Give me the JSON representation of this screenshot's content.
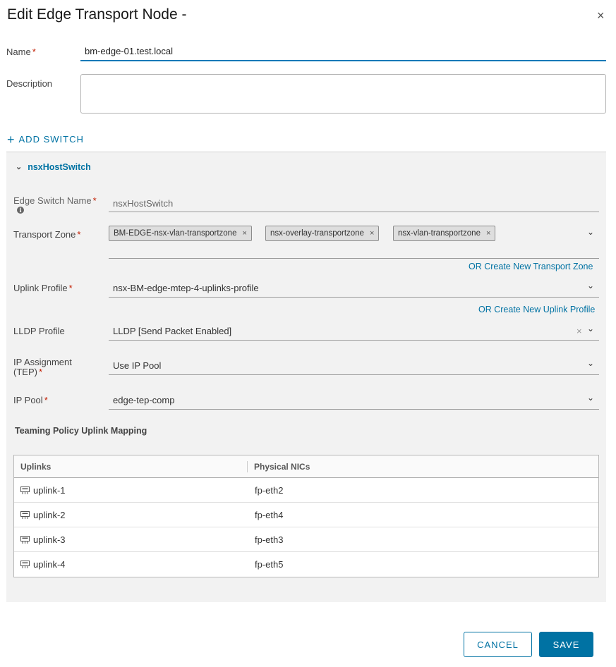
{
  "dialog": {
    "title": "Edit Edge Transport Node -",
    "close_glyph": "×"
  },
  "form": {
    "name_label": "Name",
    "required_mark": "*",
    "name_value": "bm-edge-01.test.local",
    "description_label": "Description",
    "description_value": ""
  },
  "add_switch": {
    "glyph": "+",
    "label": "ADD SWITCH"
  },
  "switch": {
    "header": "nsxHostSwitch",
    "edge_switch_name_label": "Edge Switch Name",
    "edge_switch_name_value": "nsxHostSwitch",
    "transport_zone_label": "Transport Zone",
    "transport_zones": [
      "BM-EDGE-nsx-vlan-transportzone",
      "nsx-overlay-transportzone",
      "nsx-vlan-transportzone"
    ],
    "create_transport_zone_link": "OR Create New Transport Zone",
    "uplink_profile_label": "Uplink Profile",
    "uplink_profile_value": "nsx-BM-edge-mtep-4-uplinks-profile",
    "create_uplink_profile_link": "OR Create New Uplink Profile",
    "lldp_profile_label": "LLDP Profile",
    "lldp_profile_value": "LLDP [Send Packet Enabled]",
    "ip_assignment_label_line1": "IP Assignment",
    "ip_assignment_label_line2": "(TEP)",
    "ip_assignment_value": "Use IP Pool",
    "ip_pool_label": "IP Pool",
    "ip_pool_value": "edge-tep-comp"
  },
  "teaming": {
    "title": "Teaming Policy Uplink Mapping",
    "columns": [
      "Uplinks",
      "Physical NICs"
    ],
    "rows": [
      {
        "uplink": "uplink-1",
        "nic": "fp-eth2"
      },
      {
        "uplink": "uplink-2",
        "nic": "fp-eth4"
      },
      {
        "uplink": "uplink-3",
        "nic": "fp-eth3"
      },
      {
        "uplink": "uplink-4",
        "nic": "fp-eth5"
      }
    ]
  },
  "footer": {
    "cancel_label": "CANCEL",
    "save_label": "SAVE"
  },
  "colors": {
    "accent": "#0072a3",
    "required": "#c21d00",
    "panel_bg": "#f2f2f2"
  },
  "icons": {
    "close": "close-icon",
    "add": "plus-icon",
    "chevron": "chevron-down-icon",
    "info": "info-icon",
    "uplink": "uplink-icon"
  }
}
